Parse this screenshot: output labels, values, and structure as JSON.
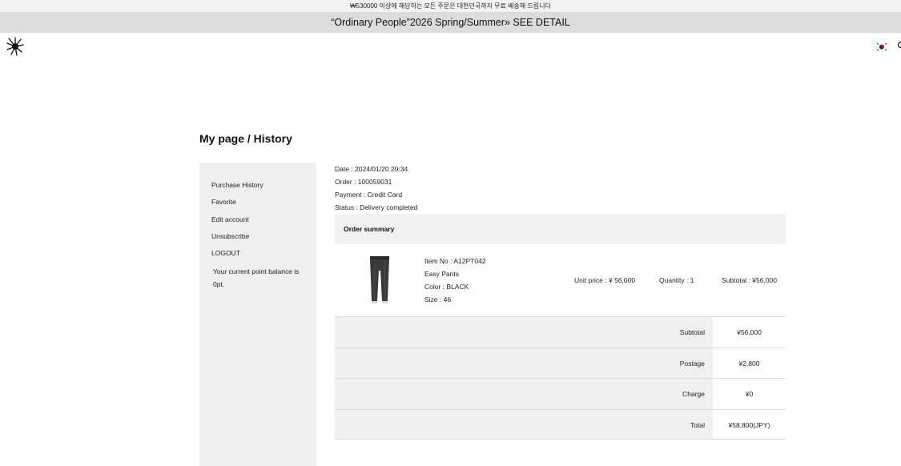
{
  "announcement": "₩530000 이상에 해당하는 모든 주문은 대한민국까지 무료 배송해 드립니다",
  "banner": {
    "text": "“Ordinary People”2026 Spring/Summer» SEE DETAIL"
  },
  "header": {
    "logo_icon": "spiky-star-logo-icon",
    "flag_icon": "korea-flag-icon"
  },
  "page_title": "My page / History",
  "sidebar": {
    "items": [
      {
        "label": "Purchase History"
      },
      {
        "label": "Favorite"
      },
      {
        "label": "Edit account"
      },
      {
        "label": "Unsubscribe"
      },
      {
        "label": "LOGOUT"
      }
    ],
    "point_balance": "Your current point balance is 0pt."
  },
  "order": {
    "date": "Date : 2024/01/20 20:34",
    "number": "Order : 100059031",
    "payment": "Payment : Credit Card",
    "status": "Status : Delivery completed"
  },
  "summary": {
    "heading": "Order summary",
    "item": {
      "item_no": "Item No : A12PT042",
      "name": "Easy Pants",
      "color": "Color : BLACK",
      "size": "Size : 46",
      "unit_price": "Unit price : ¥  56,000",
      "quantity": "Quantity : 1",
      "subtotal": "Subtotal : ¥56,000"
    },
    "totals": [
      {
        "label": "Subtotal",
        "value": "¥56,000"
      },
      {
        "label": "Postage",
        "value": "¥2,800"
      },
      {
        "label": "Charge",
        "value": "¥0"
      },
      {
        "label": "Total",
        "value": "¥58,800(JPY)"
      }
    ]
  }
}
